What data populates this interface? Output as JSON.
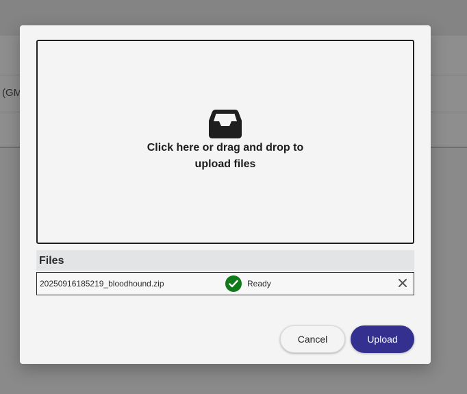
{
  "background": {
    "partial_text": "(GM"
  },
  "dropzone": {
    "icon": "inbox-icon",
    "text": "Click here or drag and drop to upload files"
  },
  "files": {
    "header": "Files",
    "items": [
      {
        "name": "20250916185219_bloodhound.zip",
        "status": "Ready",
        "status_icon": "check-circle-icon",
        "status_color": "#117a1a"
      }
    ]
  },
  "actions": {
    "cancel_label": "Cancel",
    "upload_label": "Upload",
    "upload_color": "#33308f"
  }
}
